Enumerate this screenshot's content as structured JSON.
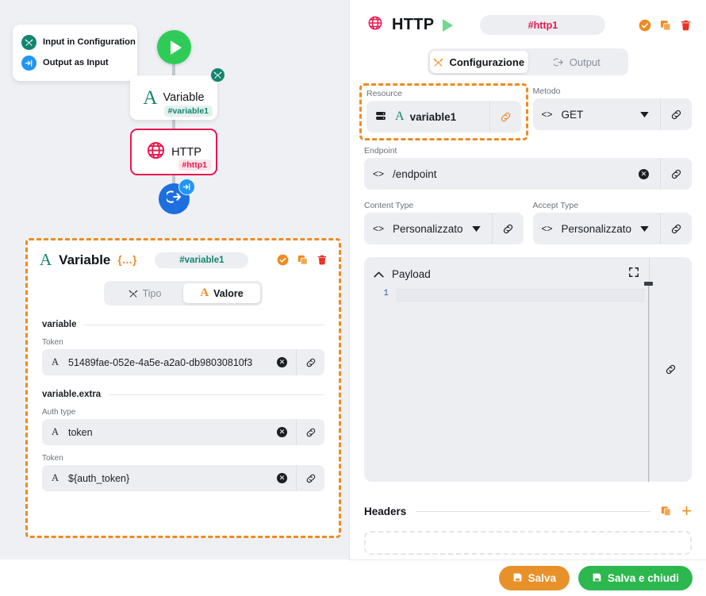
{
  "canvas": {
    "legend": {
      "items": [
        {
          "label": "Input in Configuration",
          "icon": "tools-icon"
        },
        {
          "label": "Output as Input",
          "icon": "arrow-into-bracket-icon"
        }
      ]
    },
    "start_node": {
      "icon": "play-icon"
    },
    "nodes": [
      {
        "title": "Variable",
        "tag": "#variable1",
        "icon": "letter-a-icon",
        "badge": "tools-icon"
      },
      {
        "title": "HTTP",
        "tag": "#http1",
        "icon": "globe-icon"
      }
    ],
    "end_node": {
      "icon": "output-icon",
      "badge": "arrow-into-bracket-icon"
    }
  },
  "variable_card": {
    "title": "Variable",
    "braces": "{…}",
    "name_chip": "#variable1",
    "actions": [
      {
        "name": "confirm",
        "icon": "check-circle-icon"
      },
      {
        "name": "duplicate",
        "icon": "copy-icon"
      },
      {
        "name": "delete",
        "icon": "trash-icon"
      }
    ],
    "tabs": [
      {
        "label": "Tipo",
        "icon": "tools-icon",
        "active": false
      },
      {
        "label": "Valore",
        "icon": "letter-a-icon",
        "active": true
      }
    ],
    "sections": [
      {
        "title": "variable",
        "fields": [
          {
            "label": "Token",
            "prefix": "A",
            "value": "51489fae-052e-4a5e-a2a0-db98030810f3"
          }
        ]
      },
      {
        "title": "variable.extra",
        "fields": [
          {
            "label": "Auth type",
            "prefix": "A",
            "value": "token"
          },
          {
            "label": "Token",
            "prefix": "A",
            "value": "${auth_token}"
          }
        ]
      }
    ]
  },
  "panel": {
    "title": "HTTP",
    "run_icon": "play-icon",
    "name_chip": "#http1",
    "actions": [
      {
        "name": "confirm",
        "icon": "check-circle-icon"
      },
      {
        "name": "duplicate",
        "icon": "copy-icon"
      },
      {
        "name": "delete",
        "icon": "trash-icon"
      }
    ],
    "tabs": [
      {
        "label": "Configurazione",
        "icon": "tools-icon",
        "active": true
      },
      {
        "label": "Output",
        "icon": "output-icon",
        "active": false
      }
    ],
    "fields": {
      "resource": {
        "label": "Resource",
        "value": "variable1",
        "prefix_icon": "database-icon",
        "type_icon": "letter-a-icon",
        "highlighted": true
      },
      "metodo": {
        "label": "Metodo",
        "value": "GET",
        "icon": "code-brackets-icon"
      },
      "endpoint": {
        "label": "Endpoint",
        "value": "/endpoint",
        "icon": "code-brackets-icon"
      },
      "content_type": {
        "label": "Content Type",
        "value": "Personalizzato",
        "icon": "code-brackets-icon"
      },
      "accept_type": {
        "label": "Accept Type",
        "value": "Personalizzato",
        "icon": "code-brackets-icon"
      }
    },
    "payload": {
      "title": "Payload",
      "collapse_icon": "chevron-up-icon",
      "expand_icon": "fullscreen-icon",
      "line_numbers": [
        "1"
      ],
      "content": ""
    },
    "headers": {
      "title": "Headers",
      "copy_icon": "copy-icon",
      "add_icon": "plus-icon"
    }
  },
  "bottom_bar": {
    "save_label": "Salva",
    "save_close_label": "Salva e chiudi",
    "save_icon": "floppy-icon"
  },
  "colors": {
    "orange": "#ef8b22",
    "green": "#2cb74f",
    "teal": "#12856e",
    "pink": "#e8174e",
    "blue": "#2196f3"
  }
}
